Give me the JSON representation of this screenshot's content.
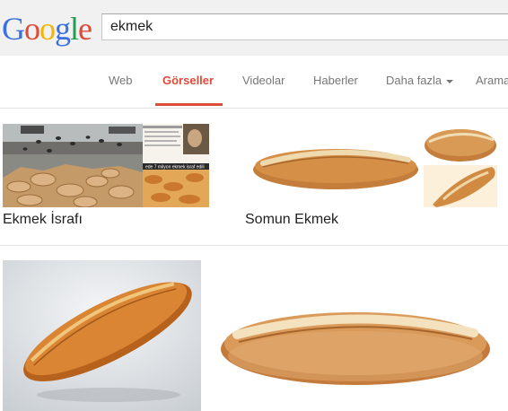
{
  "search": {
    "query": "ekmek"
  },
  "logo": {
    "letters": [
      "G",
      "o",
      "o",
      "g",
      "l",
      "e"
    ],
    "colors": [
      "#3b70e0",
      "#dd4b39",
      "#f4b400",
      "#3b70e0",
      "#1e9e50",
      "#dd4b39"
    ]
  },
  "nav": {
    "tabs": [
      {
        "label": "Web"
      },
      {
        "label": "Görseller",
        "active": true
      },
      {
        "label": "Videolar"
      },
      {
        "label": "Haberler"
      },
      {
        "label": "Daha fazla"
      },
      {
        "label": "Arama"
      }
    ],
    "accent": "#dd4b39"
  },
  "results": {
    "groups": [
      {
        "title": "Ekmek İsrafı",
        "image_text": "ede 7 milyon ekmek israf edili"
      },
      {
        "title": "Somun Ekmek"
      }
    ]
  }
}
